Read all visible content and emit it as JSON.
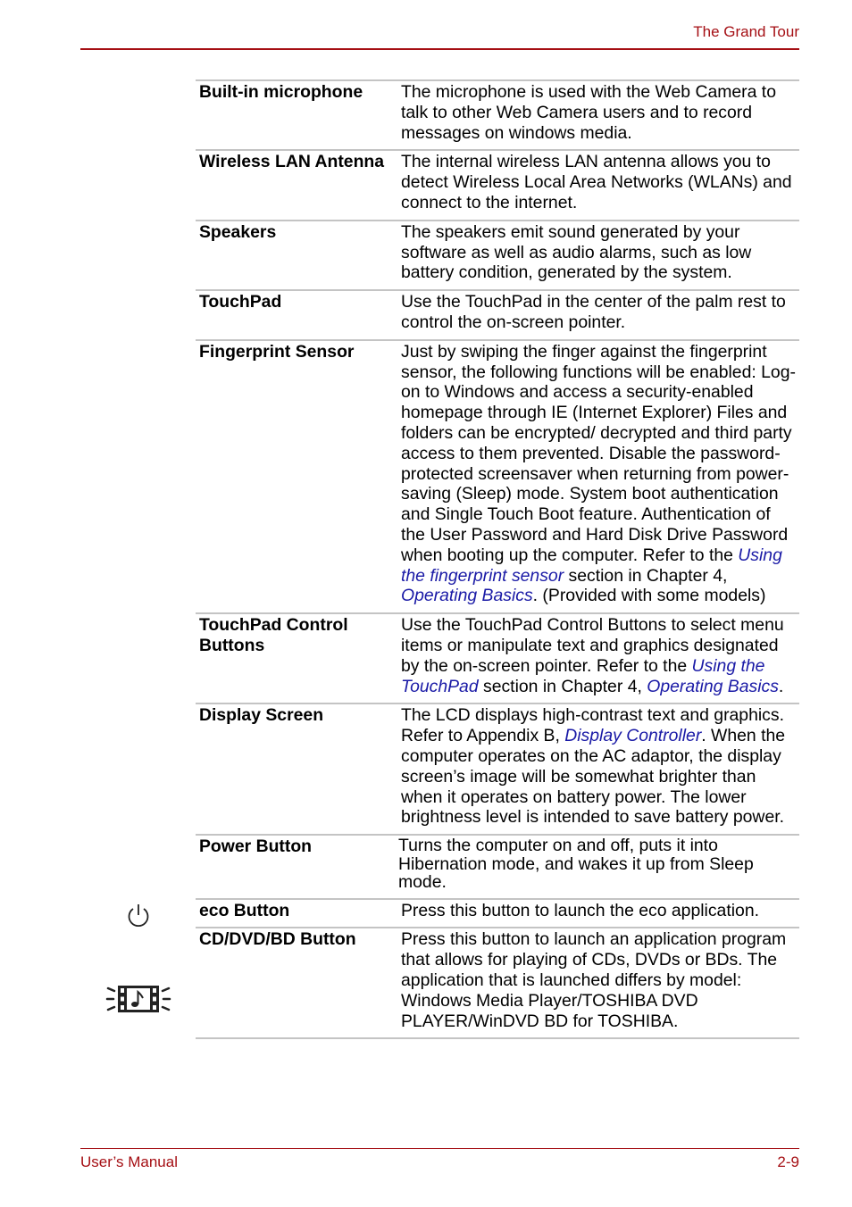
{
  "header": {
    "title": "The Grand Tour"
  },
  "footer": {
    "left": "User’s Manual",
    "right": "2-9"
  },
  "colors": {
    "accent": "#a50f14",
    "link": "#1a1aa6",
    "rule": "#c4c4c4"
  },
  "rows": [
    {
      "term": "Built-in microphone",
      "desc": [
        {
          "t": "The microphone is used with the Web Camera to talk to other Web Camera users and to record messages on windows media."
        }
      ]
    },
    {
      "term": "Wireless LAN Antenna",
      "desc": [
        {
          "t": "The internal wireless LAN antenna allows you to detect Wireless Local Area Networks (WLANs) and connect to the internet."
        }
      ]
    },
    {
      "term": "Speakers",
      "desc": [
        {
          "t": "The speakers emit sound generated by your software as well as audio alarms, such as low battery condition, generated by the system."
        }
      ]
    },
    {
      "term": "TouchPad",
      "desc": [
        {
          "t": "Use the TouchPad in the center of the palm rest to control the on-screen pointer."
        }
      ]
    },
    {
      "term": "Fingerprint Sensor",
      "desc": [
        {
          "t": "Just by swiping the finger against the fingerprint sensor, the following functions will be enabled: Log-on to Windows and access a security-enabled homepage through IE (Internet Explorer) Files and folders can be encrypted/ decrypted and third party access to them prevented. Disable the password-protected screensaver when returning from power-saving (Sleep) mode. System boot authentication and Single Touch Boot feature. Authentication of the User Password and Hard Disk Drive Password when booting up the computer. Refer to the "
        },
        {
          "t": "Using the fingerprint sensor",
          "link": true
        },
        {
          "t": " section in Chapter 4, "
        },
        {
          "t": "Operating Basics",
          "link": true
        },
        {
          "t": ". (Provided with some models)"
        }
      ]
    },
    {
      "term": "TouchPad Control Buttons",
      "desc": [
        {
          "t": "Use the TouchPad Control Buttons to select menu items or manipulate text and graphics designated by the on-screen pointer. Refer to the "
        },
        {
          "t": "Using the TouchPad",
          "link": true
        },
        {
          "t": " section in Chapter 4, "
        },
        {
          "t": "Operating Basics",
          "link": true
        },
        {
          "t": "."
        }
      ]
    },
    {
      "term": "Display Screen",
      "desc": [
        {
          "t": "The LCD displays high-contrast text and graphics. Refer to Appendix B, "
        },
        {
          "t": "Display Controller",
          "link": true
        },
        {
          "t": ". When the computer operates on the AC adaptor, the display screen’s image will be somewhat brighter than when it operates on battery power. The lower brightness level is intended to save battery power."
        }
      ]
    },
    {
      "term": "Power Button",
      "icon": "power-icon",
      "desc": [
        {
          "t": "Turns the computer on and off, puts it into Hibernation mode, and wakes it up from Sleep mode."
        }
      ]
    },
    {
      "term": "eco Button",
      "desc": [
        {
          "t": "Press this button to launch the eco application."
        }
      ]
    },
    {
      "term": "CD/DVD/BD Button",
      "icon": "cd-dvd-media-icon",
      "desc": [
        {
          "t": "Press this button to launch an application program that allows for playing of CDs, DVDs or BDs. The application that is launched differs by model: Windows Media Player/TOSHIBA DVD PLAYER/WinDVD BD for TOSHIBA."
        }
      ]
    }
  ]
}
